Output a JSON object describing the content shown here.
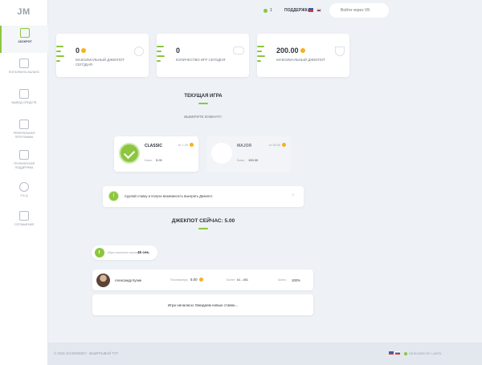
{
  "app": {
    "logo": "JM"
  },
  "sidebar": {
    "items": [
      {
        "label": "JACKPOT",
        "icon": "game-icon",
        "active": true
      },
      {
        "label": "ПОПОЛНИТЬ БАЛАНС",
        "icon": "wallet-icon",
        "active": false
      },
      {
        "label": "ВЫВОД СРЕДСТВ",
        "icon": "send-icon",
        "active": false
      },
      {
        "label": "РЕФЕРАЛЬНАЯ ПРОГРАММА",
        "icon": "referral-icon",
        "active": false
      },
      {
        "label": "ТЕХНИЧЕСКАЯ ПОДДЕРЖКА",
        "icon": "headset-icon",
        "active": false
      },
      {
        "label": "F.A.Q",
        "icon": "question-icon",
        "active": false
      },
      {
        "label": "СОГЛАШЕНИЕ",
        "icon": "document-icon",
        "active": false
      }
    ]
  },
  "header": {
    "online_count": "1",
    "support_label": "ПОДДЕРЖКА",
    "search_placeholder": "Войти через VK"
  },
  "stats": [
    {
      "value": "0",
      "label": "МАКСИМАЛЬНЫЙ ДЖЕКПОТ СЕГОДНЯ",
      "icon": "fire-icon",
      "coin": true
    },
    {
      "value": "0",
      "label": "КОЛИЧЕСТВО ИГР СЕГОДНЯ",
      "icon": "gamepad-icon",
      "coin": false
    },
    {
      "value": "200.00",
      "label": "МАКСИМАЛЬНЫЙ ДЖЕКПОТ",
      "icon": "trophy-icon",
      "coin": true
    }
  ],
  "current_game": {
    "title": "ТЕКУЩАЯ ИГРА",
    "subtitle": "ВЫБЕРИТЕ КОМНАТУ:"
  },
  "rooms": [
    {
      "name": "CLASSIC",
      "range": "от 1.00",
      "bank_label": "Банк:",
      "bank_value": "5.00",
      "selected": true
    },
    {
      "name": "MAJOR",
      "range": "от 50.00",
      "bank_label": "Банк:",
      "bank_value": "100.00",
      "selected": false
    }
  ],
  "info": {
    "icon_text": "!",
    "text": "Сделай ставку и получи возможность выиграть Джекпот.",
    "close": "×"
  },
  "jackpot": {
    "title": "ДЖЕКПОТ СЕЙЧАС: 5.00"
  },
  "timer": {
    "label": "Игра начнется через:",
    "value": "45 сек."
  },
  "player": {
    "name": "Александр Кузин",
    "bet_label": "Поставил(а):",
    "bet_value": "5.00",
    "tickets_label": "Билет:",
    "tickets_value": "#1 - #51",
    "chance_label": "Шанс:",
    "chance_value": "100%"
  },
  "status": {
    "text": "Игра началась! Ожидаем новых ставок..."
  },
  "footer": {
    "copyright": "© 2018 JACKMONEY - ВЫИГРЫВАЙ ТУТ.",
    "designer": "DESIGNED BY LAB75"
  },
  "colors": {
    "accent": "#8cc63f",
    "coin": "#f5b21b",
    "background": "#eef1f6"
  }
}
